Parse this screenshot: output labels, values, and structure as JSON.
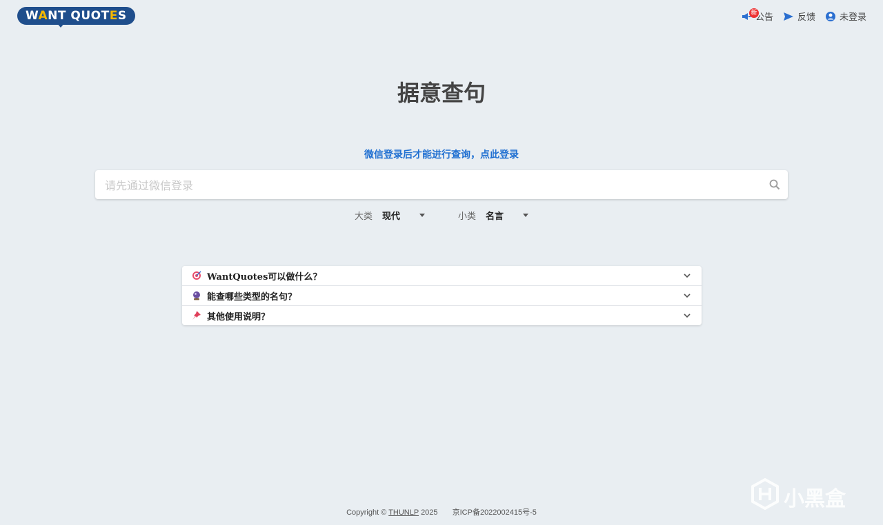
{
  "header": {
    "logo": {
      "text_start": "W",
      "text_accent_a": "A",
      "text_mid": "NT QUOT",
      "text_accent_e": "E",
      "text_end": "S"
    },
    "nav": {
      "announce_label": "公告",
      "announce_badge": "新",
      "feedback_label": "反馈",
      "login_label": "未登录"
    }
  },
  "main": {
    "title": "据意查句",
    "login_prompt": "微信登录后才能进行查询，点此登录",
    "search": {
      "placeholder": "请先通过微信登录",
      "value": ""
    },
    "filters": {
      "category_label": "大类",
      "category_value": "现代",
      "subcategory_label": "小类",
      "subcategory_value": "名言"
    },
    "faq": [
      {
        "icon": "target-icon",
        "question": "WantQuotes可以做什么？"
      },
      {
        "icon": "crystal-ball-icon",
        "question": "能查哪些类型的名句？"
      },
      {
        "icon": "pushpin-icon",
        "question": "其他使用说明？"
      }
    ]
  },
  "footer": {
    "copyright_prefix": "Copyright ©",
    "org_link": "THUNLP",
    "year": "2025",
    "icp": "京ICP备2022002415号-5"
  },
  "watermark": {
    "text": "小黑盒"
  },
  "colors": {
    "background": "#e9eef2",
    "brand": "#1f4e8c",
    "brand_accent": "#f5b800",
    "link": "#1f6fd1",
    "badge": "#e33333"
  }
}
